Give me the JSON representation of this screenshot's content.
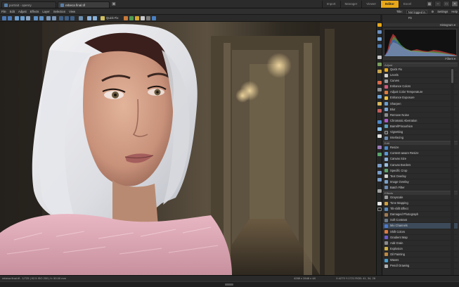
{
  "tabs": [
    {
      "label": "portrait - openry",
      "active": false
    },
    {
      "label": "rebeca final.tif",
      "active": true
    }
  ],
  "modes": [
    "Import",
    "Manager",
    "Viewer",
    "Editor",
    "Excel"
  ],
  "active_mode": "Editor",
  "menu": [
    "File",
    "Edit",
    "Adjust",
    "Effects",
    "Layer",
    "Selection",
    "View"
  ],
  "menu_right": {
    "title_label": "Title:",
    "login": "Not logged in",
    "settings": "Settings",
    "help": "Help"
  },
  "toolbar": {
    "quickfix_label": "Quick Fix"
  },
  "panel": {
    "fit_label": "Fit",
    "histogram_label": "Histogram",
    "filters_label": "Filters",
    "groups": [
      {
        "name": "Adjust",
        "items": [
          "Quick Fix",
          "Levels",
          "Curves",
          "Enhance Colors",
          "Adjust Color Temperature",
          "Enhance Exposure",
          "Sharpen",
          "Blur",
          "Remove Noise",
          "Chromatic Aberration",
          "Barrel/Pincushion",
          "Vignetting",
          "Interlacing"
        ]
      },
      {
        "name": "Edit",
        "items": [
          "Resize",
          "Content-aware Resize",
          "Canvas Size",
          "Canvas Borders",
          "Specific Crop",
          "Text Overlay",
          "Image Overlay",
          "Batch Filter"
        ]
      },
      {
        "name": "Effects",
        "items": [
          "Grayscale",
          "Tone Mapping",
          "Tilt-shift Effect",
          "Damaged Photograph",
          "Soft Contrast",
          "Mix Channels",
          "Shift Colors",
          "Gradient Map",
          "Add Grain",
          "Explosion",
          "Oil Painting",
          "Waves",
          "Pencil Drawing"
        ]
      }
    ],
    "selected_item": "Mix Channels"
  },
  "status": {
    "left": "rebeca final.tif - 1/725 | f/2.5 ISO 200 | f= 50.00 mm",
    "mid": "4288 x 2848 x 48",
    "right": "X:4279 Y:1721  RGB: 41, 34, 28"
  },
  "colors": {
    "accent": "#e8a81a",
    "selection": "#3c4a5a"
  }
}
